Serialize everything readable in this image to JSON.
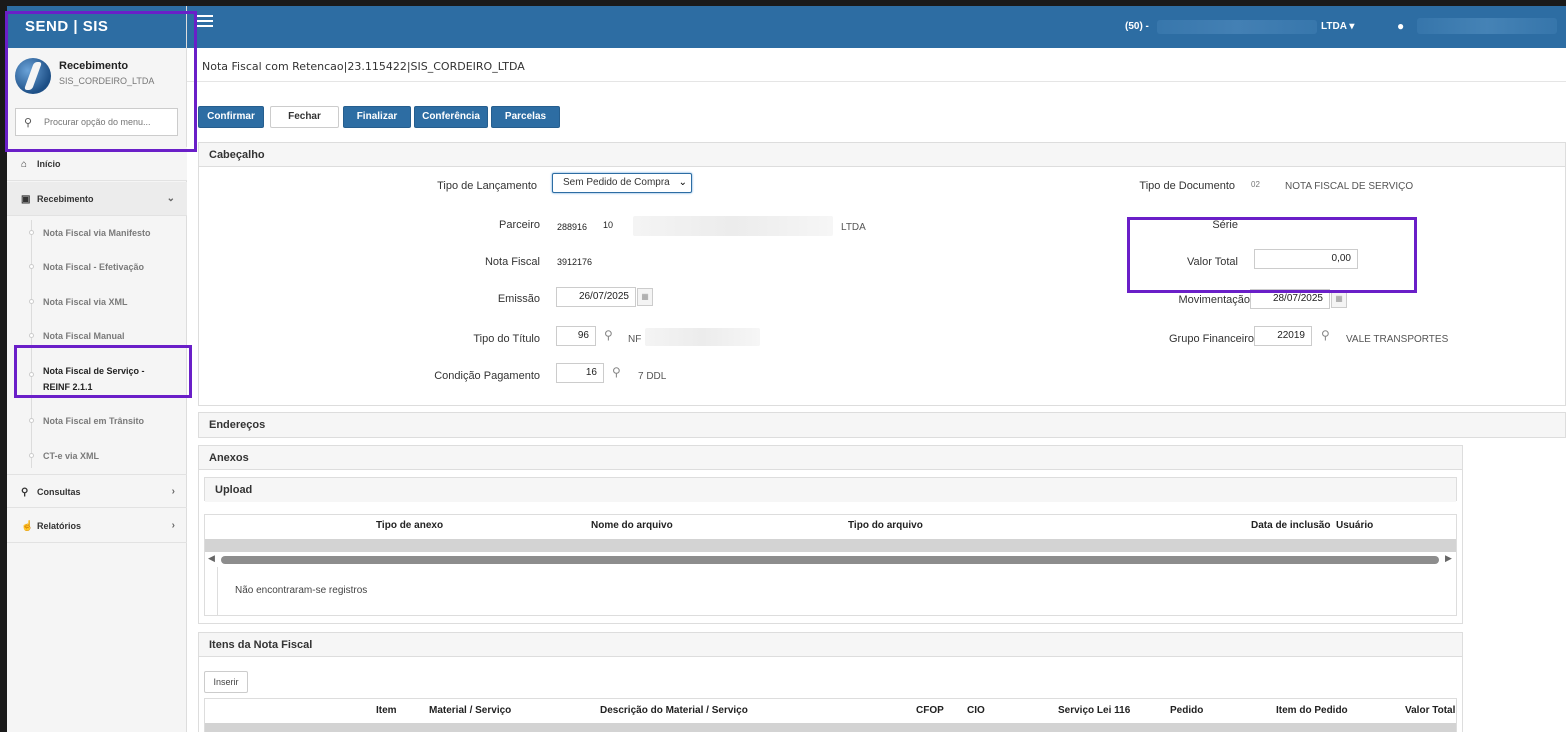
{
  "app": {
    "brand": "SEND | SIS"
  },
  "profile": {
    "title": "Recebimento",
    "subtitle": "SIS_CORDEIRO_LTDA"
  },
  "menu_search": {
    "placeholder": "Procurar opção do menu..."
  },
  "nav": {
    "inicio": "Início",
    "recebimento": "Recebimento",
    "sub_items": [
      "Nota Fiscal via Manifesto",
      "Nota Fiscal - Efetivação",
      "Nota Fiscal via XML",
      "Nota Fiscal Manual",
      "Nota Fiscal de Serviço - REINF 2.1.1",
      "Nota Fiscal em Trânsito",
      "CT-e via XML"
    ],
    "consultas": "Consultas",
    "relatorios": "Relatórios"
  },
  "topbar": {
    "code": "(50) -",
    "company_suffix": "LTDA",
    "caret": "▾"
  },
  "page": {
    "title": "Nota Fiscal com Retencao|23.115422|SIS_CORDEIRO_LTDA"
  },
  "toolbar": {
    "confirmar": "Confirmar",
    "fechar": "Fechar",
    "finalizar": "Finalizar",
    "conferencia": "Conferência",
    "parcelas": "Parcelas"
  },
  "cabecalho": {
    "title": "Cabeçalho",
    "tipo_lancamento_label": "Tipo de Lançamento",
    "tipo_lancamento_value": "Sem Pedido de Compra",
    "parceiro_label": "Parceiro",
    "parceiro_code": "288916",
    "parceiro_num": "10",
    "parceiro_suffix": "LTDA",
    "nota_fiscal_label": "Nota Fiscal",
    "nota_fiscal_value": "3912176",
    "emissao_label": "Emissão",
    "emissao_value": "26/07/2025",
    "tipo_titulo_label": "Tipo do Título",
    "tipo_titulo_value": "96",
    "tipo_titulo_desc": "NF",
    "condicao_label": "Condição Pagamento",
    "condicao_value": "16",
    "condicao_desc": "7 DDL",
    "tipo_documento_label": "Tipo de Documento",
    "tipo_documento_code": "02",
    "tipo_documento_desc": "NOTA FISCAL DE SERVIÇO",
    "serie_label": "Série",
    "valor_total_label": "Valor Total",
    "valor_total_value": "0,00",
    "movimentacao_label": "Movimentação",
    "movimentacao_value": "28/07/2025",
    "grupo_financeiro_label": "Grupo Financeiro",
    "grupo_financeiro_value": "22019",
    "grupo_financeiro_desc": "VALE TRANSPORTES"
  },
  "enderecos": {
    "title": "Endereços"
  },
  "anexos": {
    "title": "Anexos",
    "upload": "Upload",
    "columns": [
      "Tipo de anexo",
      "Nome do arquivo",
      "Tipo do arquivo",
      "Data de inclusão",
      "Usuário"
    ],
    "empty": "Não encontraram-se registros"
  },
  "itens": {
    "title": "Itens da Nota Fiscal",
    "inserir": "Inserir",
    "columns": [
      "Item",
      "Material / Serviço",
      "Descrição do Material / Serviço",
      "CFOP",
      "CIO",
      "Serviço Lei 116",
      "Pedido",
      "Item do Pedido",
      "Valor Total"
    ]
  },
  "colors": {
    "primary": "#2d6da3",
    "highlight": "#6a1fc8"
  }
}
